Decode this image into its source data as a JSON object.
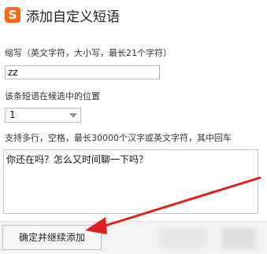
{
  "window": {
    "logo_letter": "S",
    "title": "添加自定义短语"
  },
  "abbreviation": {
    "label": "缩写（英文字符，大小写，最长21个字符）",
    "value": "zz"
  },
  "position": {
    "label": "该条短语在候选中的位置",
    "selected_value": "1"
  },
  "phrase": {
    "label": "支持多行，空格，最长30000个汉字或英文字符，其中回车",
    "value": "你还在吗？怎么又时间聊一下吗？"
  },
  "footer": {
    "confirm_continue_label": "确定并继续添加"
  },
  "colors": {
    "arrow": "#e0201c",
    "logo": "#f26b1d"
  }
}
